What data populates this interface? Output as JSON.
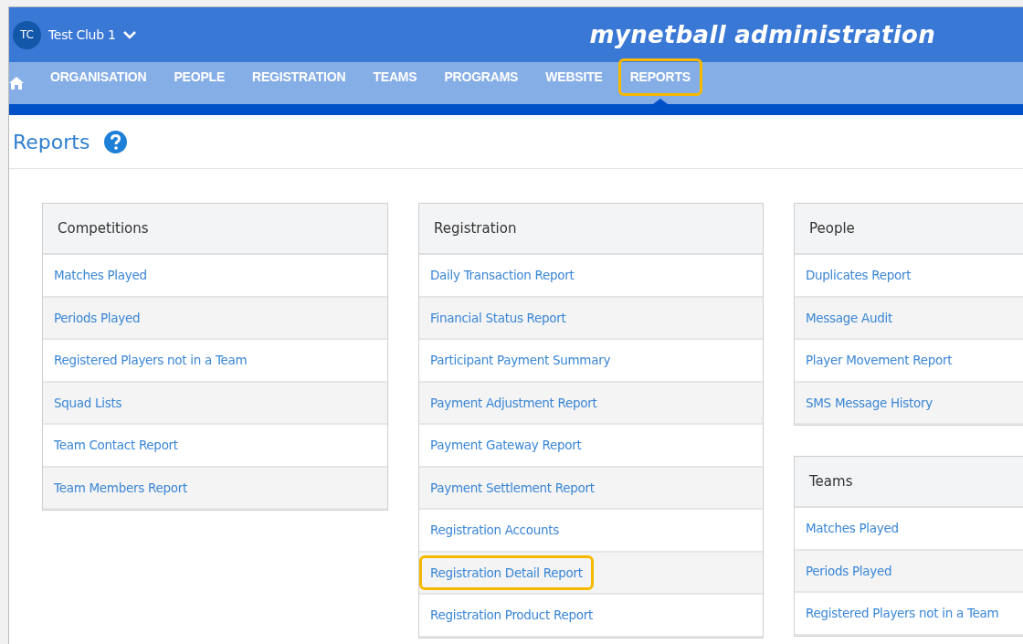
{
  "header": {
    "avatar": "TC",
    "club": "Test Club 1",
    "app_title": "mynetball administration"
  },
  "nav": [
    {
      "label": "ORGANISATION",
      "selected": false,
      "highlighted": false
    },
    {
      "label": "PEOPLE",
      "selected": false,
      "highlighted": false
    },
    {
      "label": "REGISTRATION",
      "selected": false,
      "highlighted": false
    },
    {
      "label": "TEAMS",
      "selected": false,
      "highlighted": false
    },
    {
      "label": "PROGRAMS",
      "selected": false,
      "highlighted": false
    },
    {
      "label": "WEBSITE",
      "selected": false,
      "highlighted": false
    },
    {
      "label": "REPORTS",
      "selected": true,
      "highlighted": true
    }
  ],
  "page_title": "Reports",
  "columns": [
    [
      {
        "title": "Competitions",
        "items": [
          {
            "label": "Matches Played",
            "highlighted": false
          },
          {
            "label": "Periods Played",
            "highlighted": false
          },
          {
            "label": "Registered Players not in a Team",
            "highlighted": false
          },
          {
            "label": "Squad Lists",
            "highlighted": false
          },
          {
            "label": "Team Contact Report",
            "highlighted": false
          },
          {
            "label": "Team Members Report",
            "highlighted": false
          }
        ]
      }
    ],
    [
      {
        "title": "Registration",
        "items": [
          {
            "label": "Daily Transaction Report",
            "highlighted": false
          },
          {
            "label": "Financial Status Report",
            "highlighted": false
          },
          {
            "label": "Participant Payment Summary",
            "highlighted": false
          },
          {
            "label": "Payment Adjustment Report",
            "highlighted": false
          },
          {
            "label": "Payment Gateway Report",
            "highlighted": false
          },
          {
            "label": "Payment Settlement Report",
            "highlighted": false
          },
          {
            "label": "Registration Accounts",
            "highlighted": false
          },
          {
            "label": "Registration Detail Report",
            "highlighted": true
          },
          {
            "label": "Registration Product Report",
            "highlighted": false
          }
        ]
      }
    ],
    [
      {
        "title": "People",
        "items": [
          {
            "label": "Duplicates Report",
            "highlighted": false
          },
          {
            "label": "Message Audit",
            "highlighted": false
          },
          {
            "label": "Player Movement Report",
            "highlighted": false
          },
          {
            "label": "SMS Message History",
            "highlighted": false
          }
        ]
      },
      {
        "title": "Teams",
        "items": [
          {
            "label": "Matches Played",
            "highlighted": false
          },
          {
            "label": "Periods Played",
            "highlighted": false
          },
          {
            "label": "Registered Players not in a Team",
            "highlighted": false
          }
        ]
      }
    ]
  ]
}
